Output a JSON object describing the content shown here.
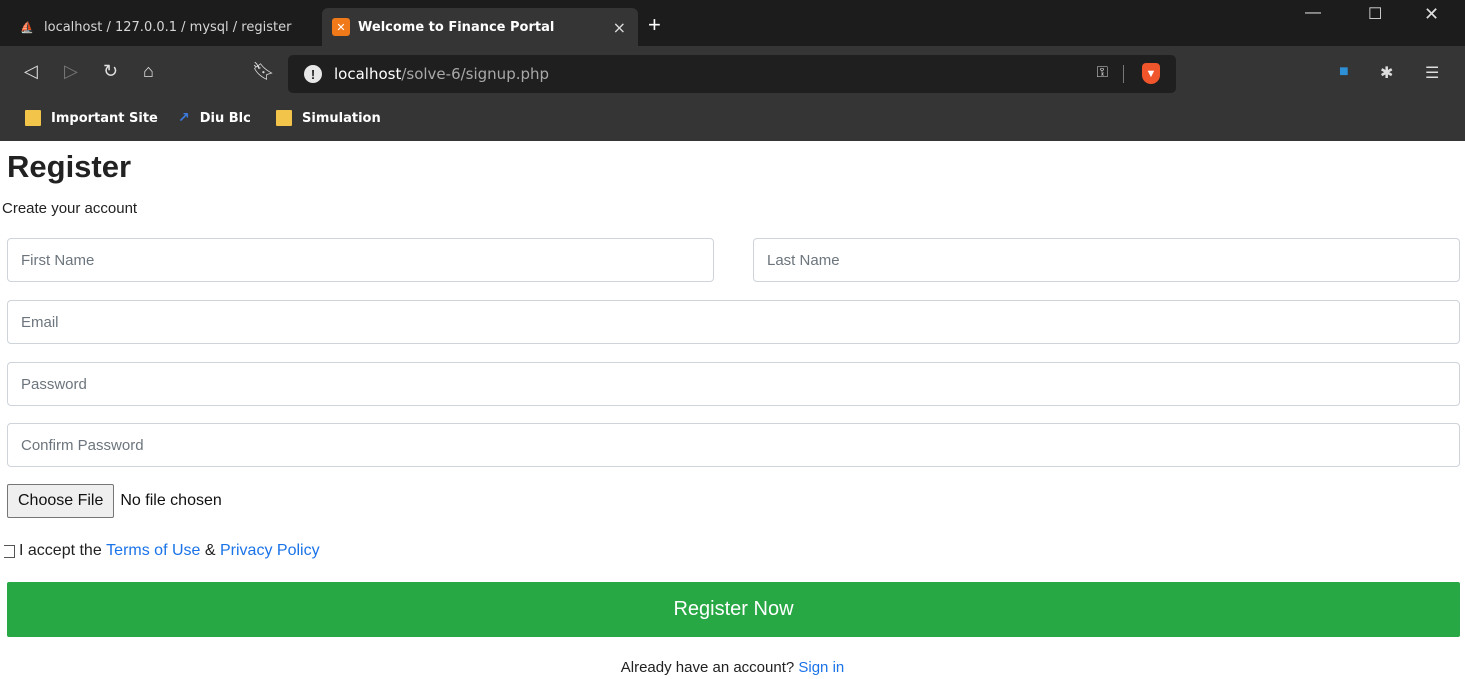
{
  "browser": {
    "tabs": [
      {
        "title": "localhost / 127.0.0.1 / mysql / register",
        "favicon": "phpmyadmin-icon"
      },
      {
        "title": "Welcome to Finance Portal",
        "favicon": "xampp-icon",
        "active": true
      }
    ],
    "new_tab_label": "+",
    "tab_close_label": "×",
    "url_host": "localhost",
    "url_path": "/solve-6/signup.php",
    "bookmarks": [
      {
        "label": "Important Site",
        "icon": "folder-icon"
      },
      {
        "label": "Diu Blc",
        "icon": "diu-icon"
      },
      {
        "label": "Simulation",
        "icon": "folder-icon"
      }
    ]
  },
  "form": {
    "title": "Register",
    "subtitle": "Create your account",
    "first_name_placeholder": "First Name",
    "last_name_placeholder": "Last Name",
    "email_placeholder": "Email",
    "password_placeholder": "Password",
    "confirm_password_placeholder": "Confirm Password",
    "file_button": "Choose File",
    "file_status": "No file chosen",
    "terms_prefix": "I accept the",
    "terms_link": "Terms of Use",
    "terms_amp": "&",
    "privacy_link": "Privacy Policy",
    "submit": "Register Now",
    "signin_prompt": "Already have an account?",
    "signin_link": "Sign in"
  },
  "colors": {
    "primary_button": "#28a745",
    "link": "#1a73e8",
    "chrome_dark": "#1c1c1c",
    "chrome_toolbar": "#353535"
  }
}
